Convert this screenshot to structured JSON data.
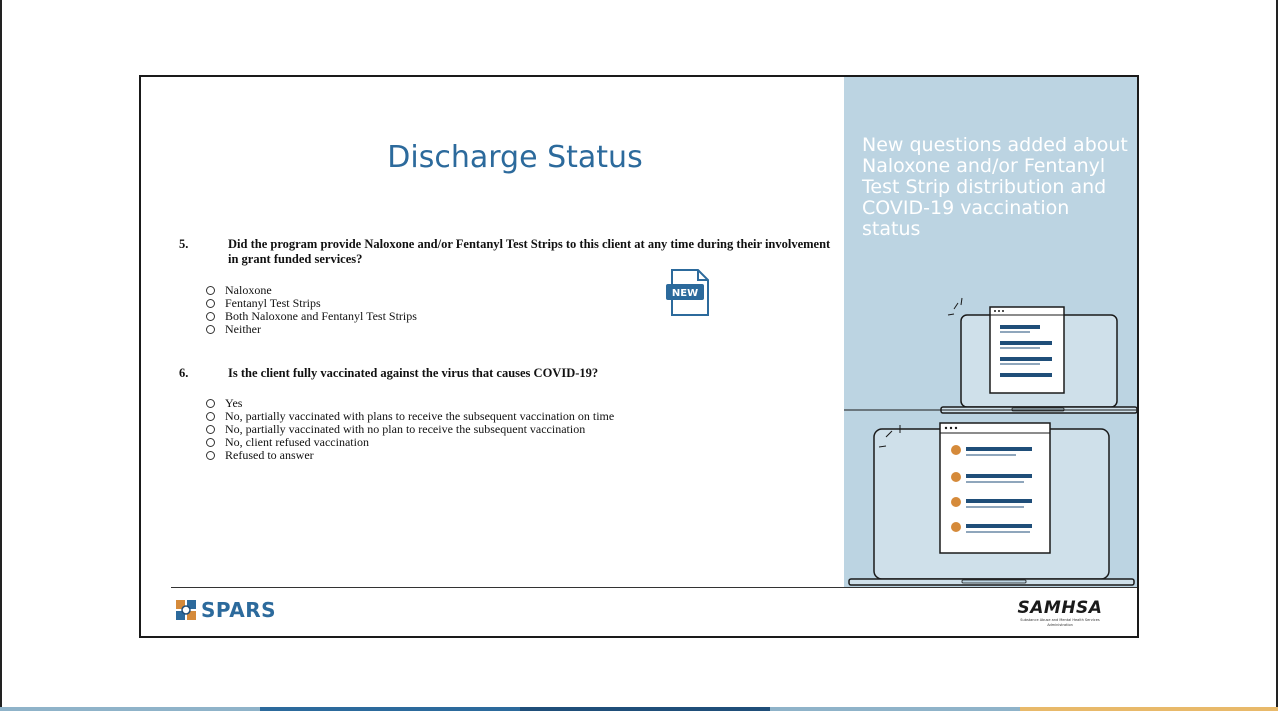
{
  "slide": {
    "title": "Discharge Status",
    "side_text": "New questions added about Naloxone and/or Fentanyl Test Strip distribution and COVID-19 vaccination status"
  },
  "question5": {
    "number": "5.",
    "text": "Did the program provide Naloxone and/or Fentanyl Test Strips to this client at any time during their involvement in grant funded services?",
    "options": [
      "Naloxone",
      "Fentanyl Test Strips",
      "Both Naloxone and Fentanyl Test Strips",
      "Neither"
    ]
  },
  "new_badge": {
    "label": "NEW",
    "icon": "new-document-icon"
  },
  "question6": {
    "number": "6.",
    "text": "Is the client fully vaccinated against the virus that causes COVID-19?",
    "options": [
      "Yes",
      "No, partially vaccinated with plans to receive the subsequent vaccination on time",
      "No, partially vaccinated with no plan to receive the subsequent vaccination",
      "No, client refused vaccination",
      "Refused to answer"
    ]
  },
  "footer": {
    "left_logo": "SPARS",
    "right_logo": "SAMHSA",
    "right_logo_subtitle": "Substance Abuse and Mental Health Services Administration"
  },
  "colors": {
    "title": "#2c6a9c",
    "side_panel": "#bcd4e2",
    "laptop_frame": "#1f4e79",
    "bullet_orange": "#d58a3a"
  }
}
